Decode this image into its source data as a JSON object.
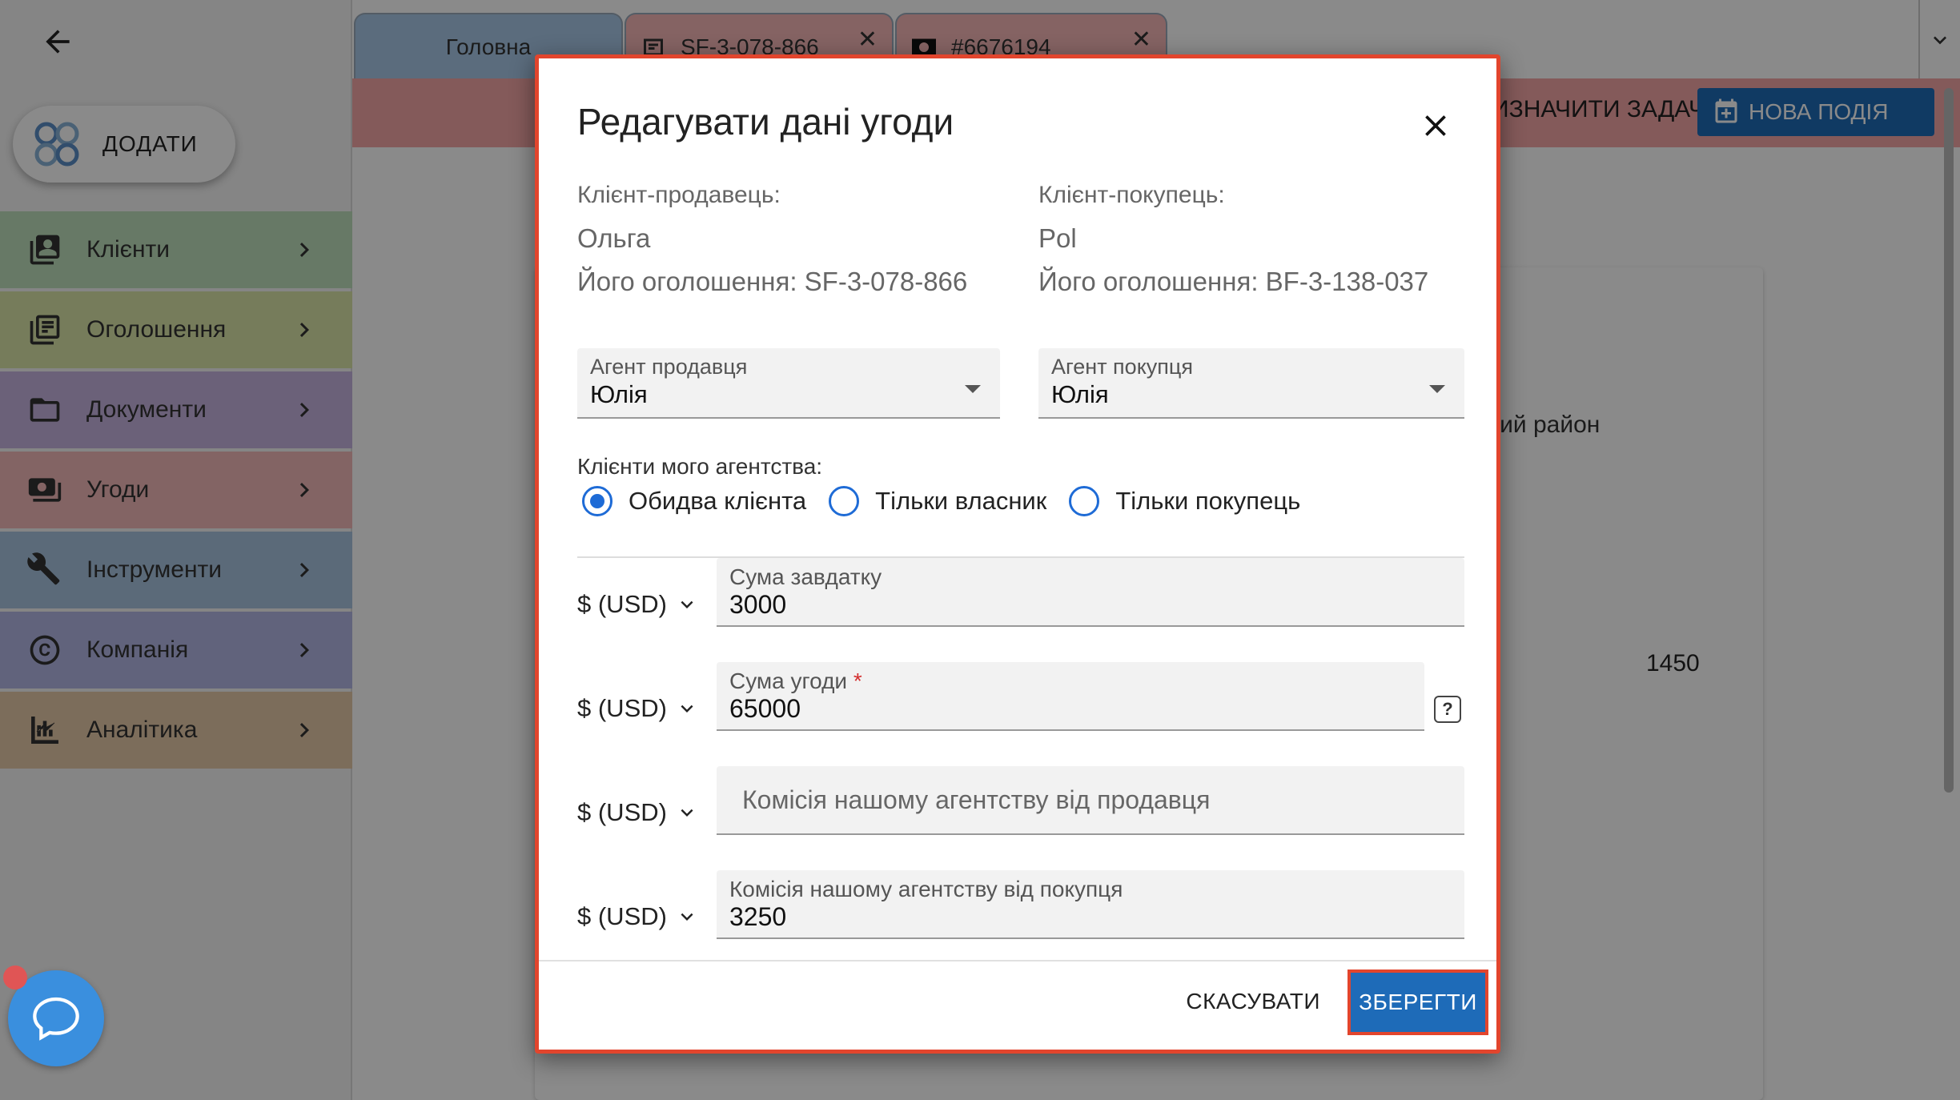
{
  "sidebar": {
    "add_label": "ДОДАТИ",
    "items": [
      {
        "label": "Клієнти",
        "icon": "contacts-icon",
        "color": "#bfe0bd"
      },
      {
        "label": "Оголошення",
        "icon": "listing-icon",
        "color": "#dbe6a8"
      },
      {
        "label": "Документи",
        "icon": "folder-icon",
        "color": "#c6b3e0"
      },
      {
        "label": "Угоди",
        "icon": "deal-icon",
        "color": "#f2b9b9"
      },
      {
        "label": "Інструменти",
        "icon": "tools-icon",
        "color": "#a8c4e0"
      },
      {
        "label": "Компанія",
        "icon": "copyright-icon",
        "color": "#b3b8e6"
      },
      {
        "label": "Аналітика",
        "icon": "analytics-icon",
        "color": "#e6c9a8"
      }
    ]
  },
  "tabs": [
    {
      "label": "Головна"
    },
    {
      "label": "SF-3-078-866"
    },
    {
      "label": "#6676194"
    }
  ],
  "toolbar": {
    "assign_label": "РИЗНАЧИТИ ЗАДАЧУ",
    "new_event_label": "НОВА ПОДІЯ"
  },
  "background": {
    "district_text": "кий район",
    "number_text": "1450"
  },
  "modal": {
    "title": "Редагувати дані угоди",
    "seller": {
      "label": "Клієнт-продавець:",
      "name": "Ольга",
      "listing": "Його оголошення: SF-3-078-866"
    },
    "buyer": {
      "label": "Клієнт-покупець:",
      "name": "Pol",
      "listing": "Його оголошення: BF-3-138-037"
    },
    "seller_agent": {
      "label": "Агент продавця",
      "value": "Юлія"
    },
    "buyer_agent": {
      "label": "Агент покупця",
      "value": "Юлія"
    },
    "clients_label": "Клієнти мого агентства:",
    "radio_options": [
      {
        "label": "Обидва клієнта",
        "selected": true
      },
      {
        "label": "Тільки власник",
        "selected": false
      },
      {
        "label": "Тільки покупець",
        "selected": false
      }
    ],
    "currency": "$ (USD)",
    "deposit": {
      "label": "Сума завдатку",
      "value": "3000"
    },
    "deal_amount": {
      "label": "Сума угоди",
      "required_mark": "*",
      "value": "65000"
    },
    "seller_commission": {
      "placeholder": "Комісія нашому агентству від продавця"
    },
    "buyer_commission": {
      "label": "Комісія нашому агентству від покупця",
      "value": "3250"
    },
    "help_glyph": "?",
    "cancel_label": "СКАСУВАТИ",
    "save_label": "ЗБЕРЕГТИ"
  }
}
